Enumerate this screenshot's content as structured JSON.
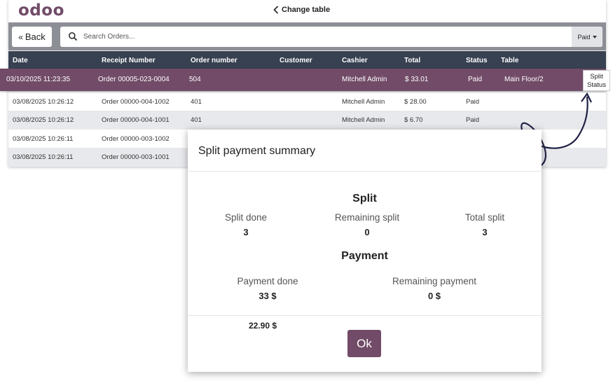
{
  "brand": {
    "logo_text": "odoo",
    "accent_color": "#714b67"
  },
  "header": {
    "change_table_label": "Change table",
    "change_table_icon": "chevron-left-icon"
  },
  "toolbar": {
    "back_label": "Back",
    "back_icon": "double-chevron-left-icon",
    "search_placeholder": "Search Orders...",
    "search_icon": "search-icon",
    "filter_value": "Paid"
  },
  "table": {
    "columns": [
      "Date",
      "Receipt Number",
      "Order number",
      "Customer",
      "Cashier",
      "Total",
      "Status",
      "Table"
    ],
    "selected_row": {
      "date": "03/10/2025 11:23:35",
      "receipt": "Order 00005-023-0004",
      "order": "504",
      "customer": "",
      "cashier": "Mitchell Admin",
      "total": "$ 33.01",
      "status": "Paid",
      "table": "Main Floor/2"
    },
    "rows": [
      {
        "date": "03/08/2025 10:26:12",
        "receipt": "Order 00000-004-1002",
        "order": "401",
        "customer": "",
        "cashier": "Mitchell Admin",
        "total": "$ 28.00",
        "status": "Paid",
        "table": ""
      },
      {
        "date": "03/08/2025 10:26:12",
        "receipt": "Order 00000-004-1001",
        "order": "401",
        "customer": "",
        "cashier": "Mitchell Admin",
        "total": "$ 6.70",
        "status": "Paid",
        "table": ""
      },
      {
        "date": "03/08/2025 10:26:11",
        "receipt": "Order 00000-003-1002",
        "order": "",
        "customer": "",
        "cashier": "",
        "total": "",
        "status": "",
        "table": ""
      },
      {
        "date": "03/08/2025 10:26:11",
        "receipt": "Order 00000-003-1001",
        "order": "",
        "customer": "",
        "cashier": "",
        "total": "",
        "status": "",
        "table": ""
      }
    ]
  },
  "callout": {
    "line1": "Split",
    "line2": "Status"
  },
  "modal": {
    "title": "Split payment summary",
    "split_section": "Split",
    "split_done_label": "Split done",
    "split_done_value": "3",
    "remaining_split_label": "Remaining split",
    "remaining_split_value": "0",
    "total_split_label": "Total split",
    "total_split_value": "3",
    "payment_section": "Payment",
    "payment_done_label": "Payment done",
    "payment_done_value": "33 $",
    "remaining_payment_label": "Remaining payment",
    "remaining_payment_value": "0 $",
    "footer_amount": "22.90 $",
    "ok_label": "Ok"
  }
}
